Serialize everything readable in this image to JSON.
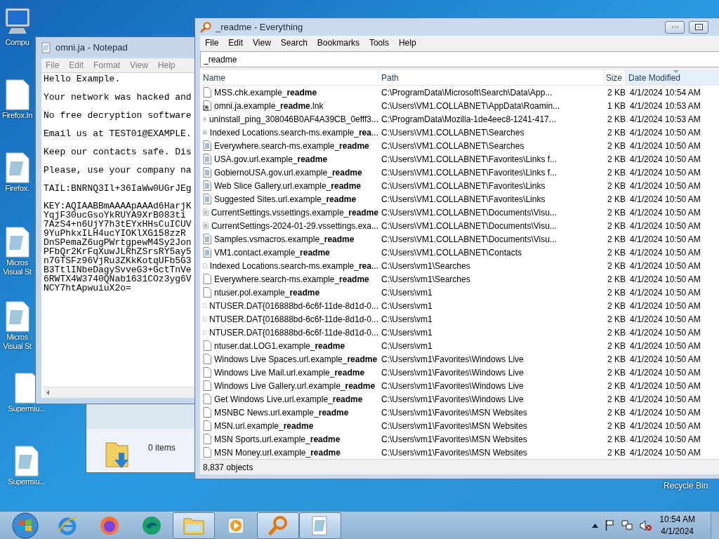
{
  "desktop_icons": [
    {
      "kind": "computer",
      "label": "Compu"
    },
    {
      "kind": "file",
      "label": "Firefox.In"
    },
    {
      "kind": "notepad",
      "label": "Firefox."
    },
    {
      "kind": "notepad",
      "label": "Micros\nVisual St"
    },
    {
      "kind": "notepad",
      "label": "Micros\nVisual St"
    },
    {
      "kind": "file",
      "label": "Supermiu..."
    },
    {
      "kind": "notepad",
      "label": "Supermiu..."
    }
  ],
  "recycle_bin": {
    "label": "Recycle Bin"
  },
  "explorer": {
    "status": "0 items"
  },
  "notepad": {
    "title": "omni.ja - Notepad",
    "menu": [
      "File",
      "Edit",
      "Format",
      "View",
      "Help"
    ],
    "paragraphs": [
      "Hello Example.",
      "Your network was hacked and",
      "No free decryption software",
      "Email us at TEST01@EXAMPLE.",
      "Keep our contacts safe. Dis",
      "Please, use your company na",
      "TAIL:BNRNQ3Il+36IaWw0UGrJEg"
    ],
    "key_lines": [
      "KEY:AQIAABBmAAAApAAAd6HarjK",
      "YqjF30ucGsoYkRUYA9XrB083ti",
      "7AzS4+n6UjY7h3tEYxHHsCuICUV",
      "9YuPhkxILH4ucYIOKlXG158zzR",
      "DnSPemaZ6ugPWrtgpewM4Sy2Jon",
      "PFbQr2KrFqXuwJLRhZSrsRY5ay5",
      "n7GTSFz96VjRu3ZKkKotqUFb5G3",
      "B3TtlINbeDagySvveG3+GctTnVe",
      "6RWTX4W3740QNab1631COz3yg6V",
      "NCY7htApwuiuX2o="
    ]
  },
  "everything": {
    "title": "_readme - Everything",
    "menu": [
      "File",
      "Edit",
      "View",
      "Search",
      "Bookmarks",
      "Tools",
      "Help"
    ],
    "search": "_readme",
    "columns": [
      {
        "label": "Name",
        "sorted": false
      },
      {
        "label": "Path",
        "sorted": false
      },
      {
        "label": "Size",
        "sorted": false
      },
      {
        "label": "Date Modified",
        "sorted": true
      }
    ],
    "rows": [
      {
        "kind": "blank",
        "name": "MSS.chk.example_**readme**",
        "path": "C:\\ProgramData\\Microsoft\\Search\\Data\\App...",
        "size": "2 KB",
        "date": "4/1/2024 10:54 AM"
      },
      {
        "kind": "shortcut",
        "name": "omni.ja.example_**readme**.lnk",
        "path": "C:\\Users\\VM1.COLLABNET\\AppData\\Roamin...",
        "size": "1 KB",
        "date": "4/1/2024 10:53 AM"
      },
      {
        "kind": "document",
        "name": "uninstall_ping_308046B0AF4A39CB_0efff3...",
        "path": "C:\\ProgramData\\Mozilla-1de4eec8-1241-417...",
        "size": "2 KB",
        "date": "4/1/2024 10:53 AM"
      },
      {
        "kind": "document",
        "name": "Indexed Locations.search-ms.example_**rea**...",
        "path": "C:\\Users\\VM1.COLLABNET\\Searches",
        "size": "2 KB",
        "date": "4/1/2024 10:50 AM"
      },
      {
        "kind": "document",
        "name": "Everywhere.search-ms.example_**readme**",
        "path": "C:\\Users\\VM1.COLLABNET\\Searches",
        "size": "2 KB",
        "date": "4/1/2024 10:50 AM"
      },
      {
        "kind": "document",
        "name": "USA.gov.url.example_**readme**",
        "path": "C:\\Users\\VM1.COLLABNET\\Favorites\\Links f...",
        "size": "2 KB",
        "date": "4/1/2024 10:50 AM"
      },
      {
        "kind": "document",
        "name": "GobiernoUSA.gov.url.example_**readme**",
        "path": "C:\\Users\\VM1.COLLABNET\\Favorites\\Links f...",
        "size": "2 KB",
        "date": "4/1/2024 10:50 AM"
      },
      {
        "kind": "document",
        "name": "Web Slice Gallery.url.example_**readme**",
        "path": "C:\\Users\\VM1.COLLABNET\\Favorites\\Links",
        "size": "2 KB",
        "date": "4/1/2024 10:50 AM"
      },
      {
        "kind": "document",
        "name": "Suggested Sites.url.example_**readme**",
        "path": "C:\\Users\\VM1.COLLABNET\\Favorites\\Links",
        "size": "2 KB",
        "date": "4/1/2024 10:50 AM"
      },
      {
        "kind": "document",
        "name": "CurrentSettings.vssettings.example_**readme**",
        "path": "C:\\Users\\VM1.COLLABNET\\Documents\\Visu...",
        "size": "2 KB",
        "date": "4/1/2024 10:50 AM"
      },
      {
        "kind": "document",
        "name": "CurrentSettings-2024-01-29.vssettings.exa...",
        "path": "C:\\Users\\VM1.COLLABNET\\Documents\\Visu...",
        "size": "2 KB",
        "date": "4/1/2024 10:50 AM"
      },
      {
        "kind": "document",
        "name": "Samples.vsmacros.example_**readme**",
        "path": "C:\\Users\\VM1.COLLABNET\\Documents\\Visu...",
        "size": "2 KB",
        "date": "4/1/2024 10:50 AM"
      },
      {
        "kind": "document",
        "name": "VM1.contact.example_**readme**",
        "path": "C:\\Users\\VM1.COLLABNET\\Contacts",
        "size": "2 KB",
        "date": "4/1/2024 10:50 AM"
      },
      {
        "kind": "blank",
        "name": "Indexed Locations.search-ms.example_**rea**...",
        "path": "C:\\Users\\vm1\\Searches",
        "size": "2 KB",
        "date": "4/1/2024 10:50 AM"
      },
      {
        "kind": "blank",
        "name": "Everywhere.search-ms.example_**readme**",
        "path": "C:\\Users\\vm1\\Searches",
        "size": "2 KB",
        "date": "4/1/2024 10:50 AM"
      },
      {
        "kind": "blank",
        "name": "ntuser.pol.example_**readme**",
        "path": "C:\\Users\\vm1",
        "size": "2 KB",
        "date": "4/1/2024 10:50 AM"
      },
      {
        "kind": "blank",
        "name": "NTUSER.DAT{016888bd-6c6f-11de-8d1d-0...",
        "path": "C:\\Users\\vm1",
        "size": "2 KB",
        "date": "4/1/2024 10:50 AM"
      },
      {
        "kind": "blank",
        "name": "NTUSER.DAT{016888bd-6c6f-11de-8d1d-0...",
        "path": "C:\\Users\\vm1",
        "size": "2 KB",
        "date": "4/1/2024 10:50 AM"
      },
      {
        "kind": "blank",
        "name": "NTUSER.DAT{016888bd-6c6f-11de-8d1d-0...",
        "path": "C:\\Users\\vm1",
        "size": "2 KB",
        "date": "4/1/2024 10:50 AM"
      },
      {
        "kind": "blank",
        "name": "ntuser.dat.LOG1.example_**readme**",
        "path": "C:\\Users\\vm1",
        "size": "2 KB",
        "date": "4/1/2024 10:50 AM"
      },
      {
        "kind": "blank",
        "name": "Windows Live Spaces.url.example_**readme**",
        "path": "C:\\Users\\vm1\\Favorites\\Windows Live",
        "size": "2 KB",
        "date": "4/1/2024 10:50 AM"
      },
      {
        "kind": "blank",
        "name": "Windows Live Mail.url.example_**readme**",
        "path": "C:\\Users\\vm1\\Favorites\\Windows Live",
        "size": "2 KB",
        "date": "4/1/2024 10:50 AM"
      },
      {
        "kind": "blank",
        "name": "Windows Live Gallery.url.example_**readme**",
        "path": "C:\\Users\\vm1\\Favorites\\Windows Live",
        "size": "2 KB",
        "date": "4/1/2024 10:50 AM"
      },
      {
        "kind": "blank",
        "name": "Get Windows Live.url.example_**readme**",
        "path": "C:\\Users\\vm1\\Favorites\\Windows Live",
        "size": "2 KB",
        "date": "4/1/2024 10:50 AM"
      },
      {
        "kind": "blank",
        "name": "MSNBC News.url.example_**readme**",
        "path": "C:\\Users\\vm1\\Favorites\\MSN Websites",
        "size": "2 KB",
        "date": "4/1/2024 10:50 AM"
      },
      {
        "kind": "blank",
        "name": "MSN.url.example_**readme**",
        "path": "C:\\Users\\vm1\\Favorites\\MSN Websites",
        "size": "2 KB",
        "date": "4/1/2024 10:50 AM"
      },
      {
        "kind": "blank",
        "name": "MSN Sports.url.example_**readme**",
        "path": "C:\\Users\\vm1\\Favorites\\MSN Websites",
        "size": "2 KB",
        "date": "4/1/2024 10:50 AM"
      },
      {
        "kind": "blank",
        "name": "MSN Money.url.example_**readme**",
        "path": "C:\\Users\\vm1\\Favorites\\MSN Websites",
        "size": "2 KB",
        "date": "4/1/2024 10:50 AM"
      }
    ],
    "status": "8,837 objects"
  },
  "taskbar": {
    "items": [
      {
        "kind": "start",
        "running": false
      },
      {
        "kind": "ie",
        "running": false
      },
      {
        "kind": "firefox",
        "running": false
      },
      {
        "kind": "edge",
        "running": false
      },
      {
        "kind": "explorer",
        "running": true
      },
      {
        "kind": "media",
        "running": false
      },
      {
        "kind": "everything",
        "running": true
      },
      {
        "kind": "notepad",
        "running": true
      }
    ],
    "tray": [
      {
        "kind": "up"
      },
      {
        "kind": "flag"
      },
      {
        "kind": "network"
      },
      {
        "kind": "speaker-muted"
      }
    ],
    "time": "10:54 AM",
    "date": "4/1/2024"
  }
}
